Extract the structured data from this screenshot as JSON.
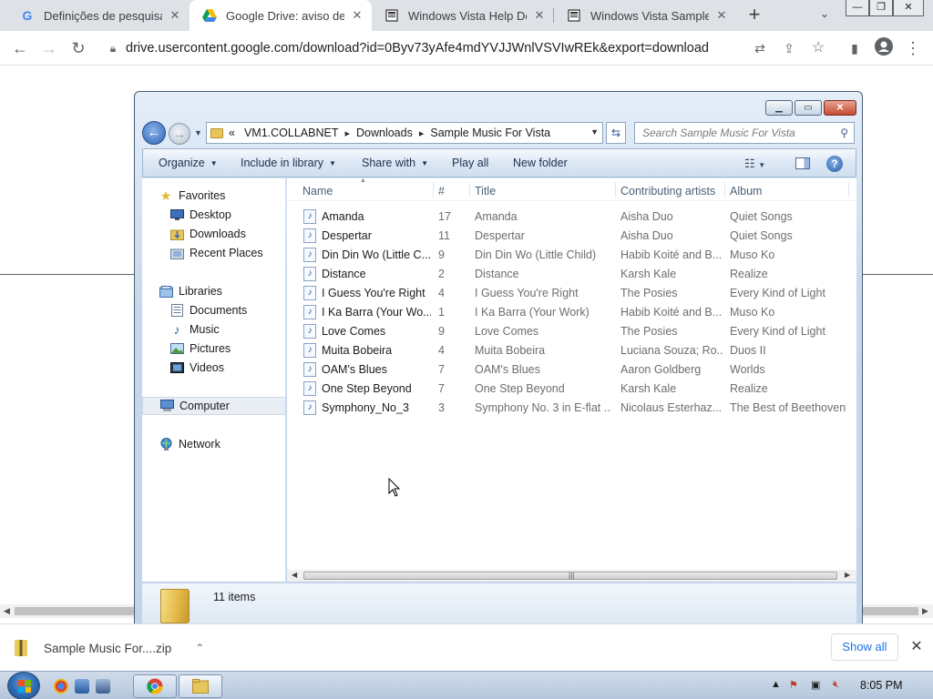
{
  "browser": {
    "tabs": [
      {
        "title": "Definições de pesquisa",
        "favicon": "G"
      },
      {
        "title": "Google Drive: aviso de ve",
        "favicon": "drive"
      },
      {
        "title": "Windows Vista Help Dem",
        "favicon": "page"
      },
      {
        "title": "Windows Vista Sample V",
        "favicon": "page"
      }
    ],
    "url": "drive.usercontent.google.com/download?id=0Byv73yAfe4mdYVJJWnlVSVIwREk&export=download"
  },
  "explorer": {
    "breadcrumb": {
      "overflow": "«",
      "segments": [
        "VM1.COLLABNET",
        "Downloads",
        "Sample Music For Vista"
      ]
    },
    "search_placeholder": "Search Sample Music For Vista",
    "commands": {
      "organize": "Organize",
      "include_in_library": "Include in library",
      "share_with": "Share with",
      "play_all": "Play all",
      "new_folder": "New folder"
    },
    "nav": {
      "favorites": "Favorites",
      "desktop": "Desktop",
      "downloads": "Downloads",
      "recent_places": "Recent Places",
      "libraries": "Libraries",
      "documents": "Documents",
      "music": "Music",
      "pictures": "Pictures",
      "videos": "Videos",
      "computer": "Computer",
      "network": "Network"
    },
    "columns": [
      "Name",
      "#",
      "Title",
      "Contributing artists",
      "Album"
    ],
    "files": [
      {
        "name": "Amanda",
        "num": "17",
        "title": "Amanda",
        "artists": "Aisha Duo",
        "album": "Quiet Songs"
      },
      {
        "name": "Despertar",
        "num": "11",
        "title": "Despertar",
        "artists": "Aisha Duo",
        "album": "Quiet Songs"
      },
      {
        "name": "Din Din Wo (Little C...",
        "num": "9",
        "title": "Din Din Wo (Little Child)",
        "artists": "Habib Koité and B...",
        "album": "Muso Ko"
      },
      {
        "name": "Distance",
        "num": "2",
        "title": "Distance",
        "artists": "Karsh Kale",
        "album": "Realize"
      },
      {
        "name": "I Guess You're Right",
        "num": "4",
        "title": "I Guess You're Right",
        "artists": "The Posies",
        "album": "Every Kind of Light"
      },
      {
        "name": "I Ka Barra (Your Wo...",
        "num": "1",
        "title": "I Ka Barra (Your Work)",
        "artists": "Habib Koité and B...",
        "album": "Muso Ko"
      },
      {
        "name": "Love Comes",
        "num": "9",
        "title": "Love Comes",
        "artists": "The Posies",
        "album": "Every Kind of Light"
      },
      {
        "name": "Muita Bobeira",
        "num": "4",
        "title": "Muita Bobeira",
        "artists": "Luciana Souza; Ro...",
        "album": "Duos II"
      },
      {
        "name": "OAM's Blues",
        "num": "7",
        "title": "OAM's Blues",
        "artists": "Aaron Goldberg",
        "album": "Worlds"
      },
      {
        "name": "One Step Beyond",
        "num": "7",
        "title": "One Step Beyond",
        "artists": "Karsh Kale",
        "album": "Realize"
      },
      {
        "name": "Symphony_No_3",
        "num": "3",
        "title": "Symphony No. 3 in E-flat ...",
        "artists": "Nicolaus Esterhaz...",
        "album": "The Best of Beethoven"
      }
    ],
    "item_count": "11 items"
  },
  "download_bar": {
    "filename": "Sample Music For....zip",
    "show_all": "Show all"
  },
  "taskbar": {
    "clock": "8:05 PM"
  },
  "colors": {
    "chrome_tabstrip": "#dee1e6",
    "link_blue": "#1a73e8",
    "vista_frame": "#c7d8ec",
    "close_red": "#c64a32"
  }
}
